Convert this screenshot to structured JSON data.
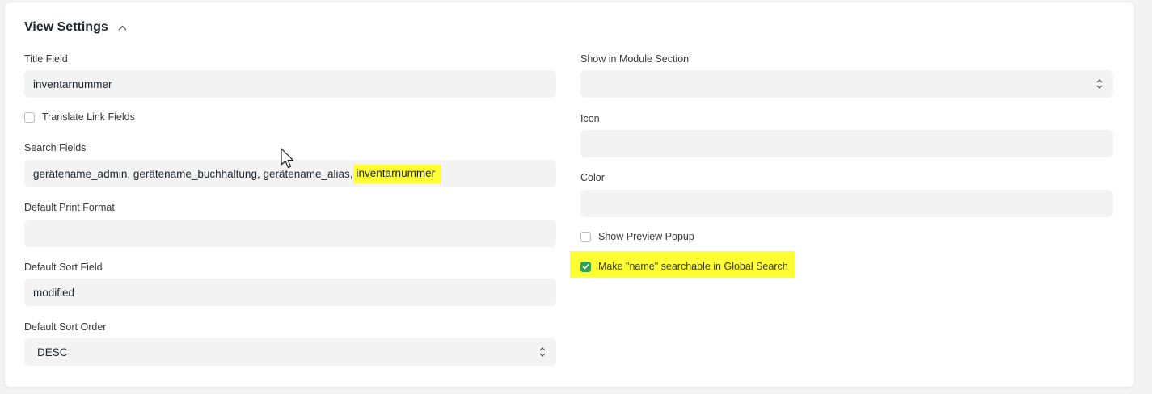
{
  "section": {
    "title": "View Settings"
  },
  "left": {
    "title_field": {
      "label": "Title Field",
      "value": "inventarnummer"
    },
    "translate_link_fields": {
      "label": "Translate Link Fields",
      "checked": false
    },
    "search_fields": {
      "label": "Search Fields",
      "value_plain": "gerätename_admin, gerätename_buchhaltung, gerätename_alias,",
      "value_highlighted": "inventarnummer"
    },
    "default_print_format": {
      "label": "Default Print Format",
      "value": ""
    },
    "default_sort_field": {
      "label": "Default Sort Field",
      "value": "modified"
    },
    "default_sort_order": {
      "label": "Default Sort Order",
      "value": "DESC"
    }
  },
  "right": {
    "show_in_module_section": {
      "label": "Show in Module Section",
      "value": ""
    },
    "icon": {
      "label": "Icon",
      "value": ""
    },
    "color": {
      "label": "Color",
      "value": ""
    },
    "show_preview_popup": {
      "label": "Show Preview Popup",
      "checked": false
    },
    "make_name_searchable": {
      "label": "Make \"name\" searchable in Global Search",
      "checked": true
    }
  },
  "colors": {
    "highlight": "#ffff33",
    "checkbox_checked": "#2ea44f",
    "field_bg": "#f3f3f3"
  }
}
